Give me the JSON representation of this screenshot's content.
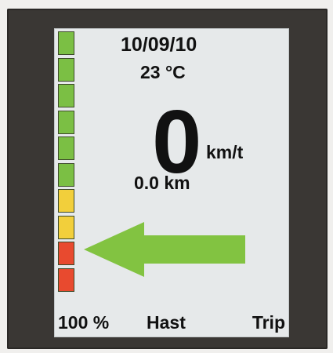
{
  "display": {
    "date": "10/09/10",
    "temperature": "23 °C",
    "speed_value": "0",
    "speed_unit": "km/t",
    "distance": "0.0 km",
    "battery_percent_label": "100 %",
    "mode_label": "Hast",
    "page_label": "Trip"
  },
  "battery_bar": {
    "level_percent": 100,
    "segments": [
      {
        "color": "#7bbf44"
      },
      {
        "color": "#7bbf44"
      },
      {
        "color": "#7bbf44"
      },
      {
        "color": "#7bbf44"
      },
      {
        "color": "#7bbf44"
      },
      {
        "color": "#7bbf44"
      },
      {
        "color": "#f2cf3b"
      },
      {
        "color": "#f2cf3b"
      },
      {
        "color": "#e84a2f"
      },
      {
        "color": "#e84a2f"
      }
    ]
  },
  "direction_arrow": {
    "icon": "arrow-left-icon",
    "color": "#82c341"
  }
}
